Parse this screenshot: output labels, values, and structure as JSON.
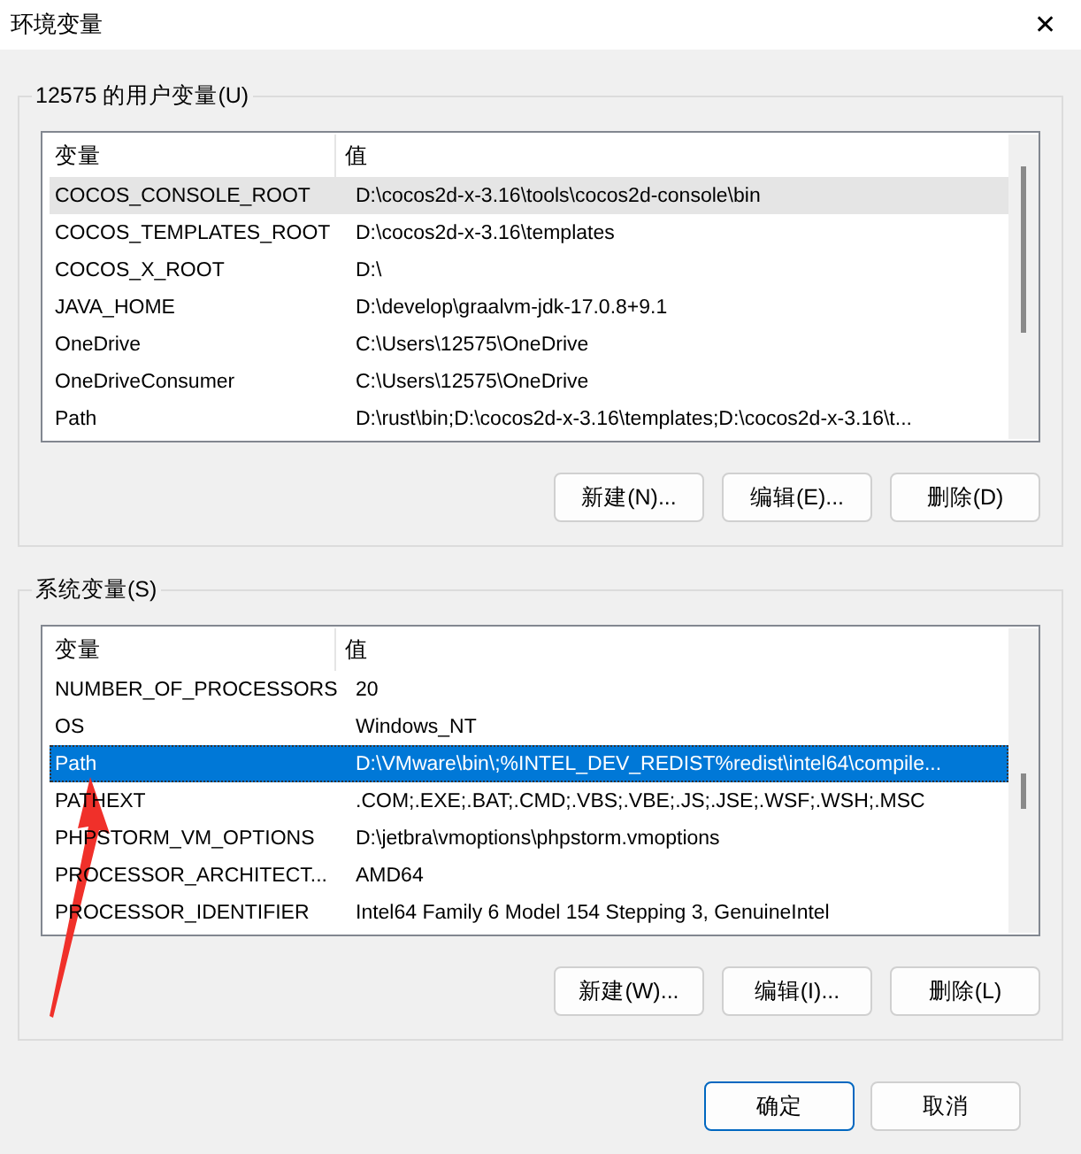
{
  "window": {
    "title": "环境变量",
    "close": "✕"
  },
  "groups": [
    {
      "title": "12575 的用户变量(U)",
      "columns": [
        "变量",
        "值"
      ],
      "rows": [
        {
          "name": "COCOS_CONSOLE_ROOT",
          "value": "D:\\cocos2d-x-3.16\\tools\\cocos2d-console\\bin",
          "selected": false,
          "hovered": true
        },
        {
          "name": "COCOS_TEMPLATES_ROOT",
          "value": "D:\\cocos2d-x-3.16\\templates",
          "selected": false,
          "hovered": false
        },
        {
          "name": "COCOS_X_ROOT",
          "value": "D:\\",
          "selected": false,
          "hovered": false
        },
        {
          "name": "JAVA_HOME",
          "value": "D:\\develop\\graalvm-jdk-17.0.8+9.1",
          "selected": false,
          "hovered": false
        },
        {
          "name": "OneDrive",
          "value": "C:\\Users\\12575\\OneDrive",
          "selected": false,
          "hovered": false
        },
        {
          "name": "OneDriveConsumer",
          "value": "C:\\Users\\12575\\OneDrive",
          "selected": false,
          "hovered": false
        },
        {
          "name": "Path",
          "value": "D:\\rust\\bin;D:\\cocos2d-x-3.16\\templates;D:\\cocos2d-x-3.16\\t...",
          "selected": false,
          "hovered": false
        }
      ],
      "buttons": [
        "新建(N)...",
        "编辑(E)...",
        "删除(D)"
      ]
    },
    {
      "title": "系统变量(S)",
      "columns": [
        "变量",
        "值"
      ],
      "rows": [
        {
          "name": "NUMBER_OF_PROCESSORS",
          "value": "20",
          "selected": false,
          "hovered": false
        },
        {
          "name": "OS",
          "value": "Windows_NT",
          "selected": false,
          "hovered": false
        },
        {
          "name": "Path",
          "value": "D:\\VMware\\bin\\;%INTEL_DEV_REDIST%redist\\intel64\\compile...",
          "selected": true,
          "hovered": false
        },
        {
          "name": "PATHEXT",
          "value": ".COM;.EXE;.BAT;.CMD;.VBS;.VBE;.JS;.JSE;.WSF;.WSH;.MSC",
          "selected": false,
          "hovered": false
        },
        {
          "name": "PHPSTORM_VM_OPTIONS",
          "value": "D:\\jetbra\\vmoptions\\phpstorm.vmoptions",
          "selected": false,
          "hovered": false
        },
        {
          "name": "PROCESSOR_ARCHITECT...",
          "value": "AMD64",
          "selected": false,
          "hovered": false
        },
        {
          "name": "PROCESSOR_IDENTIFIER",
          "value": "Intel64 Family 6 Model 154 Stepping 3, GenuineIntel",
          "selected": false,
          "hovered": false
        }
      ],
      "buttons": [
        "新建(W)...",
        "编辑(I)...",
        "删除(L)"
      ]
    }
  ],
  "footer": [
    {
      "label": "确定",
      "default": true
    },
    {
      "label": "取消",
      "default": false
    }
  ]
}
